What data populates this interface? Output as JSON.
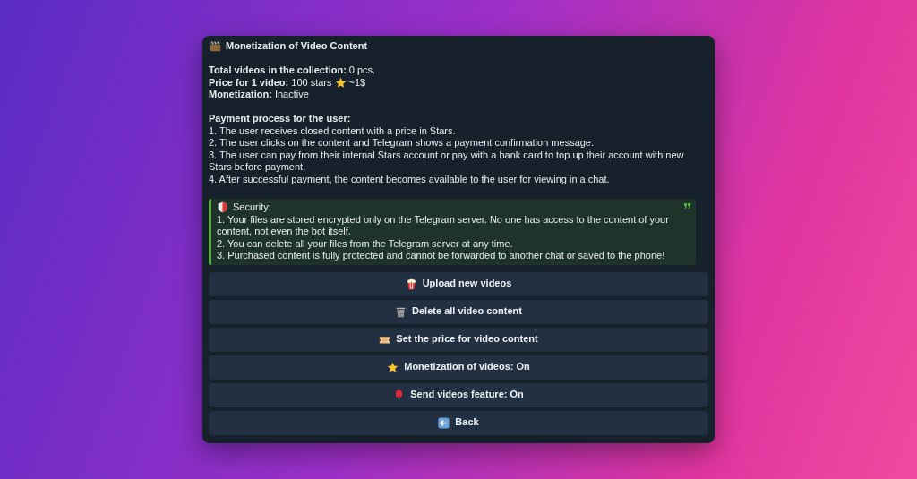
{
  "message": {
    "title": "Monetization of Video Content",
    "stats": [
      {
        "label": "Total videos in the collection:",
        "value": "0 pcs."
      },
      {
        "label": "Price for 1 video:",
        "value": "100 stars",
        "suffix": "~1$"
      },
      {
        "label": "Monetization:",
        "value": "Inactive"
      }
    ],
    "process_title": "Payment process for the user:",
    "process_steps": [
      "1. The user receives closed content with a price in Stars.",
      "2. The user clicks on the content and Telegram shows a payment confirmation message.",
      "3. The user can pay from their internal Stars account or pay with a bank card to top up their account with new Stars before payment.",
      "4. After successful payment, the content becomes available to the user for viewing in a chat."
    ],
    "quote": {
      "title": "Security:",
      "lines": [
        "1. Your files are stored encrypted only on the Telegram server. No one has access to the content of your content, not even the bot itself.",
        "2. You can delete all your files from the Telegram server at any time.",
        "3. Purchased content is fully protected and cannot be forwarded to another chat or saved to the phone!"
      ]
    }
  },
  "buttons": [
    {
      "label": "Upload new videos"
    },
    {
      "label": "Delete all video content"
    },
    {
      "label": "Set the price for video content"
    },
    {
      "label": "Monetization of videos: On"
    },
    {
      "label": "Send videos feature: On"
    },
    {
      "label": "Back"
    }
  ]
}
